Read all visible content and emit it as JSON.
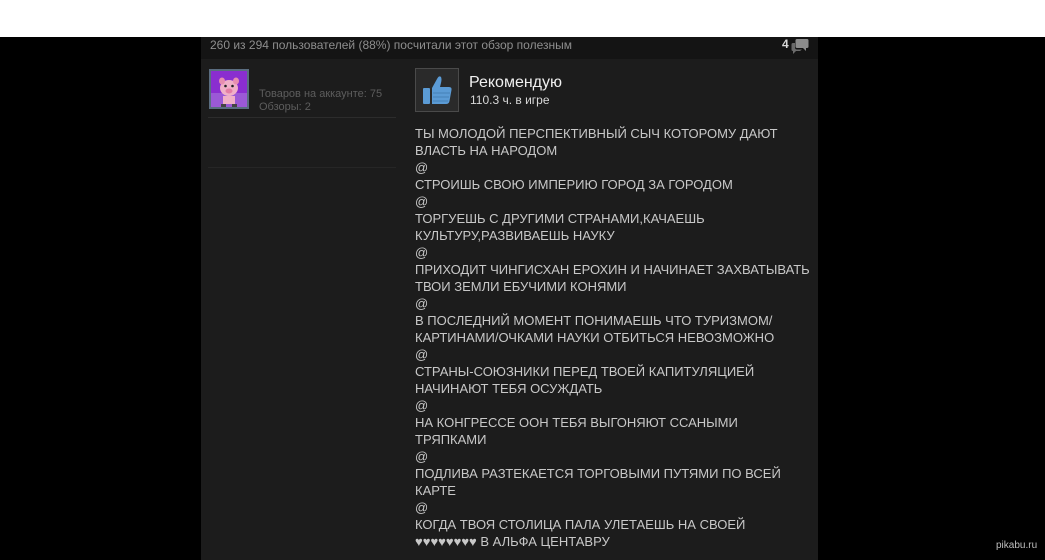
{
  "helpful_bar": {
    "text": "260 из 294 пользователей (88%) посчитали этот обзор полезным",
    "comment_count": "4"
  },
  "author": {
    "products": "Товаров на аккаунте: 75",
    "reviews": "Обзоры: 2"
  },
  "recommendation": {
    "title": "Рекомендую",
    "hours": "110.3 ч. в игре"
  },
  "review_lines": [
    "ТЫ МОЛОДОЙ ПЕРСПЕКТИВНЫЙ СЫЧ КОТОРОМУ ДАЮТ",
    "ВЛАСТЬ НА НАРОДОМ",
    "@",
    "СТРОИШЬ СВОЮ ИМПЕРИЮ ГОРОД ЗА ГОРОДОМ",
    "@",
    "ТОРГУЕШЬ С ДРУГИМИ СТРАНАМИ,КАЧАЕШЬ",
    "КУЛЬТУРУ,РАЗВИВАЕШЬ НАУКУ",
    "@",
    "ПРИХОДИТ ЧИНГИСХАН ЕРОХИН И НАЧИНАЕТ ЗАХВАТЫВАТЬ",
    "ТВОИ ЗЕМЛИ ЕБУЧИМИ КОНЯМИ",
    "@",
    "В ПОСЛЕДНИЙ МОМЕНТ ПОНИМАЕШЬ ЧТО ТУРИЗМОМ/",
    "КАРТИНАМИ/ОЧКАМИ НАУКИ ОТБИТЬСЯ НЕВОЗМОЖНО",
    "@",
    "СТРАНЫ-СОЮЗНИКИ ПЕРЕД ТВОЕЙ КАПИТУЛЯЦИЕЙ",
    "НАЧИНАЮТ ТЕБЯ ОСУЖДАТЬ",
    "@",
    "НА КОНГРЕССЕ ООН ТЕБЯ ВЫГОНЯЮТ ССАНЫМИ",
    "ТРЯПКАМИ",
    "@",
    "ПОДЛИВА РАЗТЕКАЕТСЯ ТОРГОВЫМИ ПУТЯМИ ПО ВСЕЙ",
    "КАРТЕ",
    "@",
    "КОГДА ТВОЯ СТОЛИЦА ПАЛА УЛЕТАЕШЬ НА СВОЕЙ",
    "♥♥♥♥♥♥♥♥ В АЛЬФА ЦЕНТАВРУ"
  ],
  "watermark": "pikabu.ru",
  "colors": {
    "card_bg": "#1c1c1c",
    "bar_bg": "#141414",
    "thumb_blue": "#5b9bd5",
    "text": "#c8c8c8"
  },
  "icons": {
    "comment": "speech-bubble-icon",
    "recommend": "thumbs-up-icon"
  }
}
